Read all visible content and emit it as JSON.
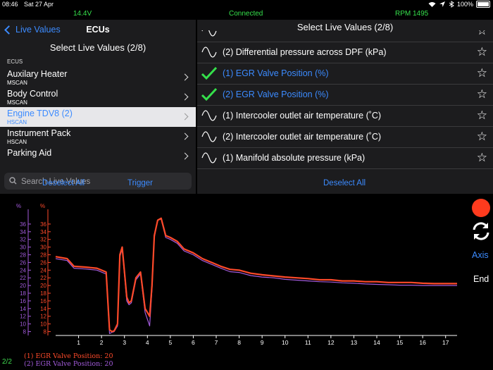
{
  "status": {
    "time": "08:46",
    "date": "Sat 27 Apr",
    "battery": "100%"
  },
  "info": {
    "voltage": "14.4V",
    "connection": "Connected",
    "rpm": "RPM 1495"
  },
  "left": {
    "back_label": "Live Values",
    "title": "ECUs",
    "select_title": "Select Live Values (2/8)",
    "section_header": "ECUS",
    "ecus": [
      {
        "name": "Auxilary Heater",
        "bus": "MSCAN",
        "selected": false
      },
      {
        "name": "Body Control",
        "bus": "MSCAN",
        "selected": false
      },
      {
        "name": "Engine TDV8 (2)",
        "bus": "HSCAN",
        "selected": true
      },
      {
        "name": "Instrument Pack",
        "bus": "HSCAN",
        "selected": false
      },
      {
        "name": "Parking Aid",
        "bus": "",
        "selected": false
      }
    ],
    "search_placeholder": "Search Live Values",
    "deselect_label": "Deselect All",
    "trigger_label": "Trigger"
  },
  "right": {
    "title": "Select Live Values (2/8)",
    "values": [
      {
        "label": "",
        "selected": false,
        "icon": "sine-wave-icon"
      },
      {
        "label": "(2) Differential pressure across DPF (kPa)",
        "selected": false,
        "icon": "sine-wave-icon"
      },
      {
        "label": "(1) EGR Valve Position (%)",
        "selected": true,
        "icon": "checkmark-icon"
      },
      {
        "label": "(2) EGR Valve Position (%)",
        "selected": true,
        "icon": "checkmark-icon"
      },
      {
        "label": "(1) Intercooler outlet air temperature (˚C)",
        "selected": false,
        "icon": "sine-wave-icon"
      },
      {
        "label": "(2) Intercooler outlet air temperature (˚C)",
        "selected": false,
        "icon": "sine-wave-icon"
      },
      {
        "label": "(1) Manifold absolute pressure (kPa)",
        "selected": false,
        "icon": "sine-wave-icon"
      }
    ],
    "deselect_label": "Deselect All"
  },
  "controls": {
    "axis_label": "Axis",
    "end_label": "End",
    "page_indicator": "2/2"
  },
  "colors": {
    "accent": "#3c8bff",
    "green": "#35e04b",
    "series1": "#ff4a2a",
    "series2": "#a35bdc",
    "record": "#ff3b1e"
  },
  "chart_data": {
    "type": "line",
    "xlim": [
      0,
      17.5
    ],
    "ylim": [
      7,
      38
    ],
    "x_ticks": [
      1,
      2,
      3,
      4,
      5,
      6,
      7,
      8,
      9,
      10,
      11,
      12,
      13,
      14,
      15,
      16,
      17
    ],
    "y_ticks": [
      8,
      10,
      12,
      14,
      16,
      18,
      20,
      22,
      24,
      26,
      28,
      30,
      32,
      34,
      36
    ],
    "y_axis_unit": "%",
    "series": [
      {
        "name": "(1) EGR Valve Position: 20",
        "color": "#ff4a2a",
        "x": [
          0,
          0.5,
          0.8,
          1.3,
          1.8,
          2.2,
          2.35,
          2.45,
          2.55,
          2.7,
          2.8,
          2.9,
          3.1,
          3.2,
          3.3,
          3.5,
          3.7,
          3.9,
          4.1,
          4.2,
          4.3,
          4.45,
          4.6,
          4.8,
          5.0,
          5.3,
          5.6,
          6.0,
          6.4,
          6.8,
          7.2,
          7.6,
          8.0,
          8.5,
          9.0,
          9.5,
          10,
          10.5,
          11,
          11.5,
          12,
          12.5,
          13,
          13.5,
          14,
          14.5,
          15,
          15.5,
          16,
          16.5,
          17,
          17.5
        ],
        "y": [
          27.5,
          27,
          25,
          24.8,
          24.5,
          23.5,
          8.5,
          8,
          8.2,
          10,
          28,
          30,
          17,
          15.5,
          16,
          22,
          23.5,
          14,
          12,
          20,
          33,
          37,
          37.5,
          33,
          32.5,
          31.5,
          29.5,
          28.5,
          27,
          26,
          25,
          24.2,
          24,
          23.2,
          22.8,
          22.5,
          22.2,
          22,
          21.8,
          21.5,
          21.5,
          21.2,
          21.2,
          21,
          21,
          20.8,
          20.8,
          20.8,
          20.6,
          20.5,
          20.5,
          20.5
        ]
      },
      {
        "name": "(2) EGR Valve Position: 20",
        "color": "#a35bdc",
        "x": [
          0,
          0.5,
          0.8,
          1.3,
          1.8,
          2.2,
          2.35,
          2.45,
          2.55,
          2.7,
          2.8,
          2.9,
          3.1,
          3.2,
          3.3,
          3.5,
          3.7,
          3.9,
          4.1,
          4.2,
          4.3,
          4.45,
          4.6,
          4.8,
          5.0,
          5.3,
          5.6,
          6.0,
          6.4,
          6.8,
          7.2,
          7.6,
          8.0,
          8.5,
          9.0,
          9.5,
          10,
          10.5,
          11,
          11.5,
          12,
          12.5,
          13,
          13.5,
          14,
          14.5,
          15,
          15.5,
          16,
          16.5,
          17,
          17.5
        ],
        "y": [
          27,
          26.5,
          24.5,
          24.3,
          24,
          23,
          7.5,
          7.8,
          8,
          9.5,
          27.5,
          29.5,
          16,
          15,
          15.5,
          21.5,
          23,
          13,
          9.5,
          19,
          32.5,
          37,
          37.3,
          32.5,
          32,
          31,
          29,
          28,
          26.5,
          25.5,
          24.5,
          23.6,
          23.4,
          22.6,
          22.2,
          22,
          21.6,
          21.4,
          21.2,
          21,
          20.9,
          20.7,
          20.6,
          20.4,
          20.3,
          20.2,
          20.1,
          20.1,
          20,
          20,
          20,
          20
        ]
      }
    ]
  }
}
